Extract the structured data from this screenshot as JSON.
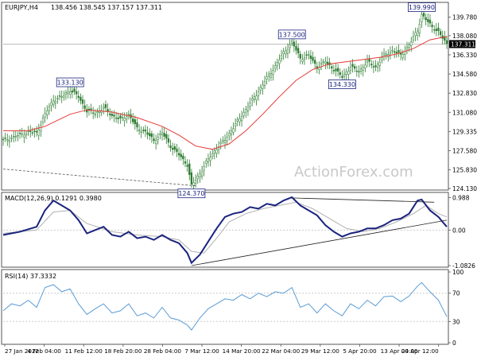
{
  "header": {
    "symbol_label": "EURJPY,H4",
    "ohlc_label": "138.456 138.545 137.157 137.311"
  },
  "watermark": "ActionForex.com",
  "colors": {
    "candle": "#2e7d32",
    "ma": "#e53935",
    "macd": "#1a237e",
    "signal": "#b0b0b0",
    "rsi": "#5b9bd5",
    "trendline": "#222222",
    "grid": "#cccccc",
    "label_border": "#1a237e",
    "current_price_bg": "#000000"
  },
  "chart_data": [
    {
      "type": "candlestick",
      "name_hint": "price",
      "title": "",
      "ylim": [
        124.13,
        140.9
      ],
      "x_ticks": [
        "27 Jan 2022",
        "4 Feb 04:00",
        "11 Feb 12:00",
        "18 Feb 20:00",
        "28 Feb 04:00",
        "7 Mar 12:00",
        "14 Mar 20:00",
        "22 Mar 04:00",
        "29 Mar 12:00",
        "5 Apr 20:00",
        "13 Apr 04:00",
        "20 Apr 12:00"
      ],
      "y_ticks": [
        124.13,
        125.83,
        127.58,
        129.335,
        131.08,
        132.83,
        134.58,
        136.33,
        138.08,
        139.78
      ],
      "y_tick_labels": [
        "124.130",
        "125.830",
        "127.580",
        "129.335",
        "131.080",
        "132.830",
        "134.580",
        "136.330",
        "138.080",
        "139.780"
      ],
      "current_price": 137.311,
      "current_price_label": "137.311",
      "close_path": [
        [
          0,
          128.5
        ],
        [
          3,
          128.9
        ],
        [
          6,
          129.3
        ],
        [
          8,
          129.2
        ],
        [
          10,
          130.9
        ],
        [
          12,
          132.2
        ],
        [
          14,
          132.5
        ],
        [
          16,
          133.13
        ],
        [
          18,
          132.5
        ],
        [
          20,
          131.2
        ],
        [
          22,
          131.0
        ],
        [
          24,
          131.5
        ],
        [
          26,
          130.8
        ],
        [
          28,
          130.4
        ],
        [
          30,
          130.9
        ],
        [
          32,
          129.6
        ],
        [
          34,
          129.3
        ],
        [
          36,
          128.5
        ],
        [
          38,
          129.2
        ],
        [
          40,
          128.0
        ],
        [
          42,
          127.2
        ],
        [
          44,
          126.3
        ],
        [
          45,
          124.37
        ],
        [
          47,
          125.5
        ],
        [
          49,
          126.8
        ],
        [
          51,
          127.8
        ],
        [
          53,
          128.6
        ],
        [
          55,
          129.7
        ],
        [
          57,
          130.8
        ],
        [
          59,
          131.9
        ],
        [
          61,
          133.0
        ],
        [
          63,
          134.2
        ],
        [
          65,
          135.3
        ],
        [
          67,
          136.5
        ],
        [
          69,
          137.5
        ],
        [
          71,
          136.0
        ],
        [
          73,
          136.3
        ],
        [
          75,
          135.2
        ],
        [
          77,
          135.7
        ],
        [
          79,
          135.0
        ],
        [
          81,
          134.33
        ],
        [
          83,
          135.2
        ],
        [
          85,
          134.8
        ],
        [
          87,
          135.7
        ],
        [
          89,
          135.2
        ],
        [
          91,
          136.3
        ],
        [
          93,
          136.7
        ],
        [
          95,
          136.3
        ],
        [
          97,
          137.2
        ],
        [
          99,
          138.6
        ],
        [
          100,
          139.99
        ],
        [
          102,
          139.1
        ],
        [
          104,
          138.4
        ],
        [
          106,
          137.311
        ]
      ],
      "ma_path": [
        [
          0,
          129.4
        ],
        [
          6,
          129.4
        ],
        [
          10,
          129.8
        ],
        [
          16,
          130.9
        ],
        [
          20,
          131.3
        ],
        [
          26,
          131.1
        ],
        [
          32,
          130.6
        ],
        [
          38,
          129.8
        ],
        [
          42,
          129.0
        ],
        [
          46,
          128.0
        ],
        [
          50,
          127.7
        ],
        [
          54,
          128.2
        ],
        [
          58,
          129.4
        ],
        [
          62,
          130.9
        ],
        [
          66,
          132.5
        ],
        [
          70,
          134.0
        ],
        [
          74,
          135.0
        ],
        [
          78,
          135.5
        ],
        [
          82,
          135.7
        ],
        [
          86,
          135.9
        ],
        [
          90,
          136.1
        ],
        [
          94,
          136.4
        ],
        [
          98,
          136.9
        ],
        [
          102,
          137.7
        ],
        [
          106,
          138.0
        ]
      ],
      "annotations": [
        {
          "label": "133.130",
          "x": 16,
          "value": 133.13,
          "at": "above"
        },
        {
          "label": "124.370",
          "x": 45,
          "value": 124.37,
          "at": "below"
        },
        {
          "label": "137.500",
          "x": 69,
          "value": 137.5,
          "at": "above"
        },
        {
          "label": "134.330",
          "x": 81,
          "value": 134.33,
          "at": "below"
        },
        {
          "label": "139.990",
          "x": 100,
          "value": 139.99,
          "at": "above"
        }
      ],
      "dashed_trend": [
        [
          0,
          125.9
        ],
        [
          46,
          124.37
        ]
      ]
    },
    {
      "type": "line",
      "name_hint": "macd",
      "title": "MACD(12,26,9) 0.1291 0.3980",
      "ylim": [
        -1.0826,
        1.05
      ],
      "y_ticks": [
        0.988,
        0.0,
        -1.0826
      ],
      "y_tick_labels": [
        "0.988",
        "0.00",
        "-1.0826"
      ],
      "series": [
        {
          "name": "",
          "values": [
            [
              0,
              -0.15
            ],
            [
              4,
              -0.05
            ],
            [
              8,
              0.1
            ],
            [
              10,
              0.6
            ],
            [
              12,
              0.9
            ],
            [
              14,
              0.75
            ],
            [
              16,
              0.6
            ],
            [
              18,
              0.3
            ],
            [
              20,
              -0.1
            ],
            [
              22,
              0.0
            ],
            [
              24,
              0.1
            ],
            [
              26,
              -0.15
            ],
            [
              28,
              -0.2
            ],
            [
              30,
              -0.05
            ],
            [
              32,
              -0.25
            ],
            [
              34,
              -0.2
            ],
            [
              36,
              -0.3
            ],
            [
              38,
              -0.15
            ],
            [
              40,
              -0.3
            ],
            [
              42,
              -0.4
            ],
            [
              44,
              -0.7
            ],
            [
              45,
              -1.0
            ],
            [
              47,
              -0.75
            ],
            [
              49,
              -0.35
            ],
            [
              51,
              0.05
            ],
            [
              53,
              0.4
            ],
            [
              55,
              0.5
            ],
            [
              57,
              0.55
            ],
            [
              59,
              0.7
            ],
            [
              61,
              0.65
            ],
            [
              63,
              0.8
            ],
            [
              65,
              0.75
            ],
            [
              67,
              0.9
            ],
            [
              69,
              1.0
            ],
            [
              71,
              0.75
            ],
            [
              73,
              0.6
            ],
            [
              75,
              0.45
            ],
            [
              77,
              0.15
            ],
            [
              79,
              -0.05
            ],
            [
              81,
              -0.2
            ],
            [
              83,
              -0.1
            ],
            [
              85,
              -0.05
            ],
            [
              87,
              0.05
            ],
            [
              89,
              0.05
            ],
            [
              91,
              0.15
            ],
            [
              93,
              0.3
            ],
            [
              95,
              0.35
            ],
            [
              97,
              0.5
            ],
            [
              99,
              0.9
            ],
            [
              100,
              0.93
            ],
            [
              102,
              0.6
            ],
            [
              104,
              0.4
            ],
            [
              106,
              0.1
            ]
          ]
        },
        {
          "name": "",
          "values": [
            [
              0,
              -0.1
            ],
            [
              8,
              0.0
            ],
            [
              12,
              0.55
            ],
            [
              16,
              0.6
            ],
            [
              20,
              0.2
            ],
            [
              26,
              -0.05
            ],
            [
              32,
              -0.15
            ],
            [
              38,
              -0.2
            ],
            [
              42,
              -0.3
            ],
            [
              45,
              -0.65
            ],
            [
              48,
              -0.7
            ],
            [
              51,
              -0.25
            ],
            [
              54,
              0.25
            ],
            [
              58,
              0.5
            ],
            [
              62,
              0.65
            ],
            [
              66,
              0.75
            ],
            [
              70,
              0.85
            ],
            [
              74,
              0.65
            ],
            [
              78,
              0.35
            ],
            [
              82,
              0.05
            ],
            [
              86,
              -0.05
            ],
            [
              90,
              0.05
            ],
            [
              94,
              0.25
            ],
            [
              98,
              0.5
            ],
            [
              101,
              0.75
            ],
            [
              104,
              0.5
            ],
            [
              106,
              0.4
            ]
          ]
        }
      ],
      "trendlines": [
        {
          "from": [
            45,
            -1.0826
          ],
          "to": [
            106,
            0.3
          ]
        },
        {
          "from": [
            69,
            0.98
          ],
          "to": [
            103,
            0.85
          ]
        }
      ]
    },
    {
      "type": "line",
      "name_hint": "rsi",
      "title": "RSI(14) 37.3332",
      "ylim": [
        0,
        100
      ],
      "y_ticks": [
        100,
        70,
        30,
        0
      ],
      "y_tick_labels": [
        "100",
        "70",
        "30",
        "0"
      ],
      "series": [
        {
          "name": "",
          "values": [
            [
              0,
              45
            ],
            [
              2,
              55
            ],
            [
              4,
              52
            ],
            [
              6,
              60
            ],
            [
              8,
              50
            ],
            [
              10,
              78
            ],
            [
              12,
              82
            ],
            [
              14,
              72
            ],
            [
              16,
              76
            ],
            [
              18,
              55
            ],
            [
              20,
              40
            ],
            [
              22,
              48
            ],
            [
              24,
              55
            ],
            [
              26,
              42
            ],
            [
              28,
              45
            ],
            [
              30,
              55
            ],
            [
              32,
              38
            ],
            [
              34,
              42
            ],
            [
              36,
              35
            ],
            [
              38,
              50
            ],
            [
              40,
              35
            ],
            [
              42,
              32
            ],
            [
              44,
              25
            ],
            [
              45,
              18
            ],
            [
              47,
              35
            ],
            [
              49,
              48
            ],
            [
              51,
              55
            ],
            [
              53,
              62
            ],
            [
              55,
              60
            ],
            [
              57,
              68
            ],
            [
              59,
              62
            ],
            [
              61,
              70
            ],
            [
              63,
              65
            ],
            [
              65,
              72
            ],
            [
              67,
              70
            ],
            [
              69,
              78
            ],
            [
              71,
              50
            ],
            [
              73,
              55
            ],
            [
              75,
              42
            ],
            [
              77,
              55
            ],
            [
              79,
              45
            ],
            [
              81,
              38
            ],
            [
              83,
              55
            ],
            [
              85,
              48
            ],
            [
              87,
              60
            ],
            [
              89,
              52
            ],
            [
              91,
              65
            ],
            [
              93,
              66
            ],
            [
              95,
              58
            ],
            [
              97,
              66
            ],
            [
              99,
              80
            ],
            [
              100,
              85
            ],
            [
              102,
              72
            ],
            [
              104,
              60
            ],
            [
              106,
              37
            ]
          ]
        }
      ]
    }
  ]
}
